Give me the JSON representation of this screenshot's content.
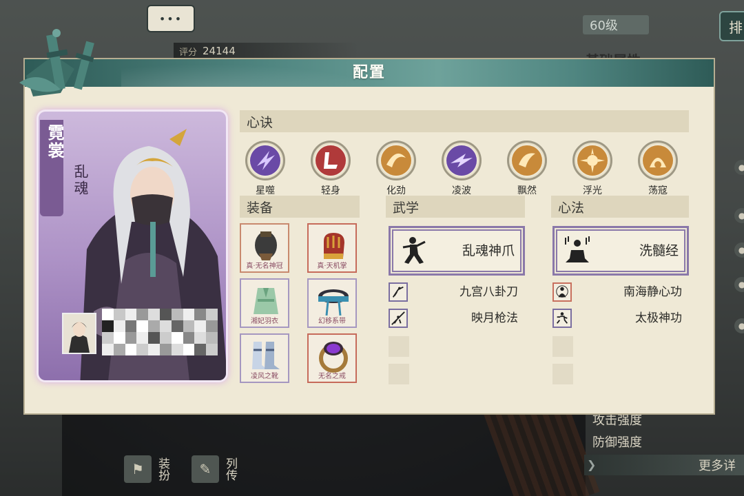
{
  "background": {
    "score_label": "评分",
    "score_value": "24144",
    "level": "60级",
    "top_button": "排",
    "attr_heading": "基础属性",
    "stats": [
      "攻击强度",
      "防御强度"
    ],
    "more_button": "更多详",
    "tab_buttons": [
      {
        "label": "装扮"
      },
      {
        "label": "列传"
      }
    ],
    "chat_bubble": "•••"
  },
  "dialog": {
    "title": "配置",
    "character": {
      "name": "霓裳",
      "title": "乱魂"
    },
    "sections": {
      "xinjue": "心诀",
      "equipment": "装备",
      "wuxue": "武学",
      "xinfa": "心法"
    },
    "xinjue_skills": [
      {
        "label": "星噬",
        "color": "#6a4aa6"
      },
      {
        "label": "轻身",
        "color": "#b03a3a"
      },
      {
        "label": "化劲",
        "color": "#c88a3a"
      },
      {
        "label": "凌波",
        "color": "#6a4aa6"
      },
      {
        "label": "飘然",
        "color": "#c88a3a"
      },
      {
        "label": "浮光",
        "color": "#c88a3a"
      },
      {
        "label": "荡寇",
        "color": "#c88a3a"
      }
    ],
    "equipment": [
      {
        "name": "真·无名神冠",
        "border": "#c8896e"
      },
      {
        "name": "真·天机掌",
        "border": "#c66a5a"
      },
      {
        "name": "湘妃羽衣",
        "border": "#a597c0"
      },
      {
        "name": "幻移系带",
        "border": "#a597c0"
      },
      {
        "name": "凌风之靴",
        "border": "#a597c0"
      },
      {
        "name": "无名之戒",
        "border": "#c66a5a"
      }
    ],
    "wuxue": {
      "main": "乱魂神爪",
      "subs": [
        "九宫八卦刀",
        "映月枪法"
      ]
    },
    "xinfa": {
      "main": "洗髓经",
      "subs": [
        "南海静心功",
        "太极神功"
      ]
    }
  }
}
